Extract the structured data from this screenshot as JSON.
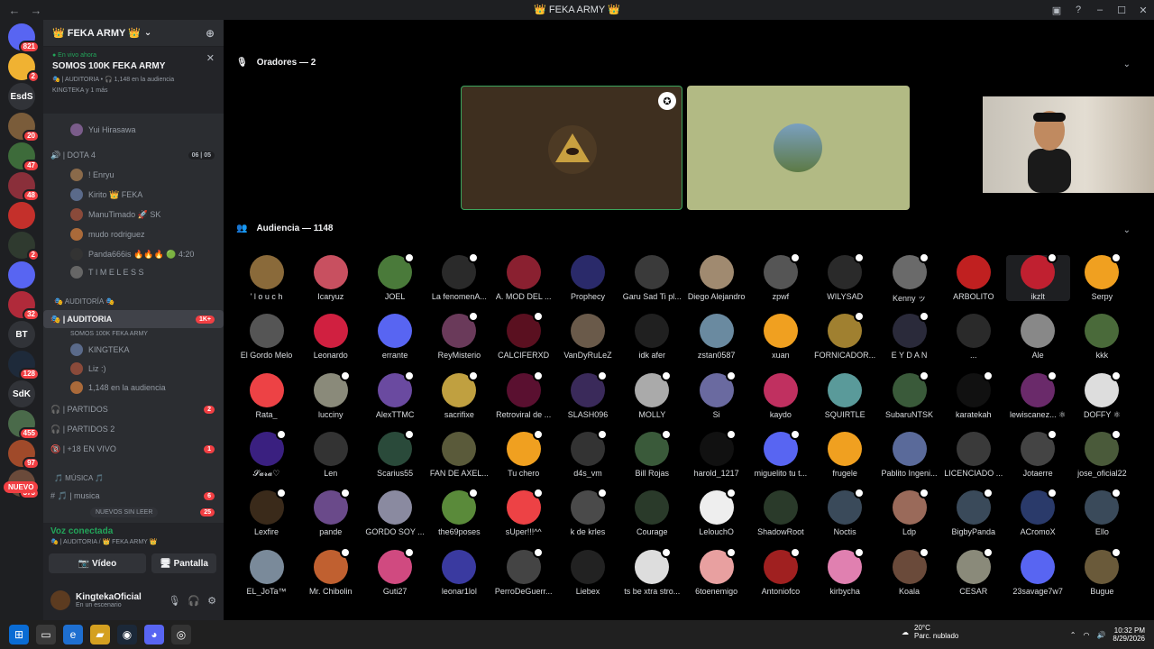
{
  "window": {
    "title": "👑 FEKA ARMY 👑"
  },
  "rail": {
    "servers": [
      {
        "label": "",
        "badge": "821",
        "color": "#5865f2"
      },
      {
        "label": "",
        "badge": "2",
        "color": "#f0b232"
      },
      {
        "label": "EsdS",
        "badge": "",
        "color": "#313338"
      },
      {
        "label": "",
        "badge": "20",
        "color": "#7a5c3a"
      },
      {
        "label": "",
        "badge": "47",
        "color": "#3d6b3a"
      },
      {
        "label": "",
        "badge": "48",
        "color": "#8a2f3a"
      },
      {
        "label": "",
        "badge": "",
        "color": "#c4302b"
      },
      {
        "label": "",
        "badge": "2",
        "color": "#2f3a2f"
      },
      {
        "label": "",
        "badge": "",
        "color": "#5865f2"
      },
      {
        "label": "",
        "badge": "32",
        "color": "#b02a3a"
      },
      {
        "label": "BT",
        "badge": "",
        "color": "#313338"
      },
      {
        "label": "",
        "badge": "128",
        "color": "#1e2a3a"
      },
      {
        "label": "SdK",
        "badge": "",
        "color": "#313338"
      },
      {
        "label": "",
        "badge": "455",
        "color": "#4a6a4a"
      },
      {
        "label": "",
        "badge": "97",
        "color": "#a04a2a"
      },
      {
        "label": "",
        "badge": "373",
        "color": "#6a4a3a"
      }
    ],
    "nuevo": "NUEVO"
  },
  "sidebar": {
    "guild_name": "👑 FEKA ARMY 👑",
    "live": {
      "label": "● En vivo ahora",
      "title": "SOMOS 100K FEKA ARMY",
      "meta": "🎭 | AUDITORIA • 🎧 1,148 en la audiencia",
      "hosts": "KINGTEKA y 1 más"
    },
    "rows": [
      {
        "text": "Yui Hirasawa",
        "type": "user"
      },
      {
        "text": "🔊 | DOTA 4",
        "type": "channel",
        "extra": "06 | 05"
      },
      {
        "text": "! Enryu",
        "type": "user"
      },
      {
        "text": "Kirito 👑 FEKA",
        "type": "user"
      },
      {
        "text": "ManuTimado 🚀 SK",
        "type": "user"
      },
      {
        "text": "mudo rodriguez",
        "type": "user"
      },
      {
        "text": "Panda666is 🔥🔥🔥 🟢 4:20",
        "type": "user"
      },
      {
        "text": "T I M E L E S S",
        "type": "user"
      },
      {
        "text": "🎭 AUDITORÍA 🎭",
        "type": "category"
      },
      {
        "text": "🎭 | AUDITORIA",
        "type": "active",
        "extra": "1K+"
      },
      {
        "text": "SOMOS 100K FEKA ARMY",
        "type": "sub"
      },
      {
        "text": "KINGTEKA",
        "type": "user"
      },
      {
        "text": "Liz :)",
        "type": "user"
      },
      {
        "text": "1,148 en la audiencia",
        "type": "user"
      },
      {
        "text": "🎧 | PARTIDOS",
        "type": "channel",
        "extra": "2"
      },
      {
        "text": "🎧 | PARTIDOS 2",
        "type": "channel",
        "extra": ""
      },
      {
        "text": "🔞 | +18 EN VIVO",
        "type": "channel",
        "extra": "1"
      },
      {
        "text": "🎵 MÚSICA 🎵",
        "type": "category"
      },
      {
        "text": "# 🎵 | musica",
        "type": "channel",
        "extra": "6"
      },
      {
        "text": "NUEVOS SIN LEER",
        "type": "unread",
        "extra": "25"
      }
    ],
    "voice": {
      "status": "Voz conectada",
      "sub": "🎭 | AUDITORIA / 👑 FEKA ARMY 👑",
      "video": "Vídeo",
      "screen": "Pantalla"
    },
    "user": {
      "name": "KingtekaOficial",
      "status": "En un escenario"
    }
  },
  "main": {
    "speakers_header": "Oradores — 2",
    "audience_header": "Audiencia — 1148",
    "audience": [
      "' l o u c h",
      "Icaryuz",
      "JOEL",
      "La fenomenA...",
      "A. MOD DEL ...",
      "Prophecy",
      "Garu Sad Ti pl...",
      "Diego Alejandro",
      "zpwf",
      "WILYSAD",
      "Kenny ッ",
      "ARBOLITO",
      "ikzlt",
      "Serpy",
      "El Gordo Melo",
      "Leonardo",
      "errante",
      "ReyMisterio",
      "CALCIFERXD",
      "VanDyRuLeZ",
      "idk afer",
      "zstan0587",
      "xuan",
      "FORNICADOR...",
      "E Y D A N",
      "...",
      "Ale",
      "kkk",
      "Rata_",
      "lucciny",
      "AlexTTMC",
      "sacrifixe",
      "Retroviral de ...",
      "SLASH096",
      "MOLLY",
      "Si",
      "kaydo",
      "SQUIRTLE",
      "SubaruNTSK",
      "karatekah",
      "lewiscanez... ⚛",
      "DOFFY ⚛",
      "𝓢𝓪𝓻𝓪♡",
      "Len",
      "Scarius55",
      "FAN DE AXEL...",
      "Tu chero",
      "d4s_vm",
      "Bill Rojas",
      "harold_1217",
      "miguelito tu t...",
      "frugele",
      "Pablito Ingeni...",
      "LICENCIADO ...",
      "Jotaerre",
      "jose_oficial22",
      "Lexfire",
      "pande",
      "GORDO SOY ...",
      "the69poses",
      "sUper!!!^^",
      "k de krles",
      "Courage",
      "LelouchO",
      "ShadowRoot",
      "Noctis",
      "Ldp",
      "BigbyPanda",
      "ACromoX",
      "Ello",
      "EL_JoTa™",
      "Mr. Chibolin",
      "Guti27",
      "leonar1lol",
      "PerroDeGuerr...",
      "Liebex",
      "ts be xtra stro...",
      "6toenemigo",
      "Antoniofco",
      "kirbycha",
      "Koala",
      "CESAR",
      "23savage7w7",
      "Bugue"
    ],
    "avatar_colors": [
      "#8a6a3a",
      "#c85060",
      "#4a7a3a",
      "#2a2a2a",
      "#8a2030",
      "#2a2a6a",
      "#3a3a3a",
      "#a08a70",
      "#555",
      "#2a2a2a",
      "#6a6a6a",
      "#c02020",
      "#c02030",
      "#f0a020",
      "#555",
      "#d02040",
      "#5865f2",
      "#6a3a5a",
      "#5a1020",
      "#6a5a4a",
      "#202020",
      "#6a8aa0",
      "#f0a020",
      "#a08030",
      "#2a2a3a",
      "#2a2a2a",
      "#888",
      "#4a6a3a",
      "#ed4245",
      "#8a8a7a",
      "#6a4aa0",
      "#c0a040",
      "#5a1030",
      "#3a2a5a",
      "#aaa",
      "#6a6aa0",
      "#c03060",
      "#5a9a9a",
      "#3a5a3a",
      "#111",
      "#6a2a6a",
      "#ddd",
      "#3a2080",
      "#333",
      "#2a4a3a",
      "#5a5a3a",
      "#f0a020",
      "#333",
      "#3a5a3a",
      "#111",
      "#5865f2",
      "#f0a020",
      "#5a6a9a",
      "#3a3a3a",
      "#444",
      "#4a5a3a",
      "#3a2a1a",
      "#6a4a8a",
      "#8a8aa0",
      "#5a8a3a",
      "#ed4245",
      "#4a4a4a",
      "#2a3a2a",
      "#eee",
      "#2a3a2a",
      "#3a4a5a",
      "#9a6a5a",
      "#3a4a5a",
      "#2a3a6a",
      "#3a4a5a",
      "#7a8a9a",
      "#c06030",
      "#d04a80",
      "#3a3aa0",
      "#444",
      "#222",
      "#ddd",
      "#e8a0a0",
      "#a02020",
      "#e080b0",
      "#6a4a3a",
      "#8a8a7a",
      "#5865f2",
      "#6a5a3a"
    ]
  },
  "taskbar": {
    "temp": "20°C",
    "weather": "Parc. nublado",
    "time": "10:32 PM",
    "date": "8/29/2026"
  }
}
